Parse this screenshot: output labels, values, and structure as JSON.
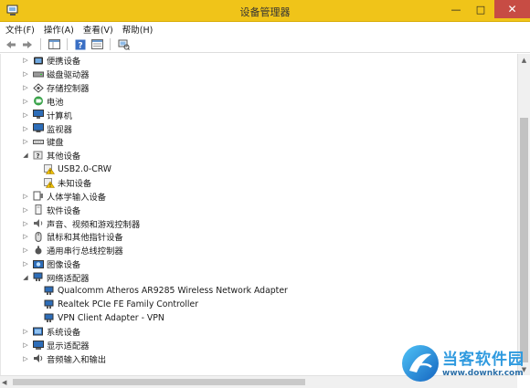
{
  "window": {
    "title": "设备管理器",
    "titlebar_color": "#f0c419",
    "close_color": "#c74c44"
  },
  "menu": [
    "文件(F)",
    "操作(A)",
    "查看(V)",
    "帮助(H)"
  ],
  "toolbar": [
    "back-arrow-icon",
    "forward-arrow-icon",
    "properties-panel-icon",
    "help-icon",
    "details-view-icon",
    "scan-hardware-icon"
  ],
  "tree": {
    "items": [
      {
        "label": "便携设备",
        "level": 0,
        "expanded": false,
        "icon": "portable-device-icon"
      },
      {
        "label": "磁盘驱动器",
        "level": 0,
        "expanded": false,
        "icon": "disk-drive-icon"
      },
      {
        "label": "存储控制器",
        "level": 0,
        "expanded": false,
        "icon": "storage-controller-icon"
      },
      {
        "label": "电池",
        "level": 0,
        "expanded": false,
        "icon": "battery-icon"
      },
      {
        "label": "计算机",
        "level": 0,
        "expanded": false,
        "icon": "computer-icon"
      },
      {
        "label": "监视器",
        "level": 0,
        "expanded": false,
        "icon": "monitor-icon"
      },
      {
        "label": "键盘",
        "level": 0,
        "expanded": false,
        "icon": "keyboard-icon"
      },
      {
        "label": "其他设备",
        "level": 0,
        "expanded": true,
        "icon": "unknown-device-icon"
      },
      {
        "label": "USB2.0-CRW",
        "level": 1,
        "icon": "warning-device-icon"
      },
      {
        "label": "未知设备",
        "level": 1,
        "icon": "warning-device-icon"
      },
      {
        "label": "人体学输入设备",
        "level": 0,
        "expanded": false,
        "icon": "hid-icon"
      },
      {
        "label": "软件设备",
        "level": 0,
        "expanded": false,
        "icon": "software-device-icon"
      },
      {
        "label": "声音、视频和游戏控制器",
        "level": 0,
        "expanded": false,
        "icon": "speaker-icon"
      },
      {
        "label": "鼠标和其他指针设备",
        "level": 0,
        "expanded": false,
        "icon": "mouse-icon"
      },
      {
        "label": "通用串行总线控制器",
        "level": 0,
        "expanded": false,
        "icon": "usb-icon"
      },
      {
        "label": "图像设备",
        "level": 0,
        "expanded": false,
        "icon": "camera-icon"
      },
      {
        "label": "网络适配器",
        "level": 0,
        "expanded": true,
        "icon": "network-adapter-icon"
      },
      {
        "label": "Qualcomm Atheros AR9285 Wireless Network Adapter",
        "level": 1,
        "icon": "network-adapter-icon"
      },
      {
        "label": "Realtek PCIe FE Family Controller",
        "level": 1,
        "icon": "network-adapter-icon"
      },
      {
        "label": "VPN Client Adapter - VPN",
        "level": 1,
        "icon": "network-adapter-icon"
      },
      {
        "label": "系统设备",
        "level": 0,
        "expanded": false,
        "icon": "system-device-icon"
      },
      {
        "label": "显示适配器",
        "level": 0,
        "expanded": false,
        "icon": "display-adapter-icon"
      },
      {
        "label": "音频输入和输出",
        "level": 0,
        "expanded": false,
        "icon": "audio-io-icon"
      }
    ]
  },
  "watermark": {
    "name": "当客软件园",
    "url": "www.downkr.com",
    "icon": "downkr-logo-icon"
  }
}
